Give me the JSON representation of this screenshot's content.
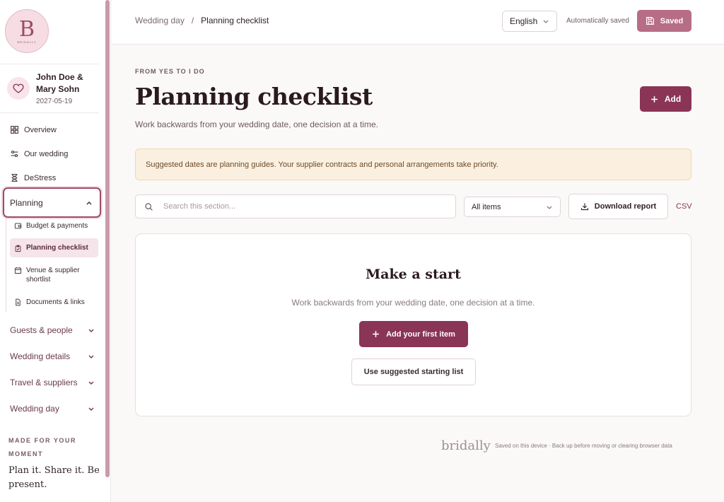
{
  "brand": {
    "logo_letter": "B",
    "logo_caption": "BRIDALLY",
    "footer_name": "bridally"
  },
  "couple": {
    "names": "John Doe & Mary Sohn",
    "date": "2027-05-19"
  },
  "nav": {
    "overview": "Overview",
    "our_wedding": "Our wedding",
    "destress": "DeStress",
    "planning": "Planning",
    "planning_items": [
      {
        "label": "Budget & payments",
        "icon": "wallet-icon"
      },
      {
        "label": "Planning checklist",
        "icon": "clipboard-check-icon",
        "active": true
      },
      {
        "label": "Venue & supplier shortlist",
        "icon": "calendar-icon"
      },
      {
        "label": "Documents & links",
        "icon": "document-icon"
      }
    ],
    "groups": [
      "Guests & people",
      "Wedding details",
      "Travel & suppliers",
      "Wedding day"
    ]
  },
  "sidebar_footer": {
    "eyebrow": "MADE FOR YOUR MOMENT",
    "tagline": "Plan it. Share it. Be present."
  },
  "topbar": {
    "breadcrumb_parent": "Wedding day",
    "breadcrumb_sep": "/",
    "breadcrumb_current": "Planning checklist",
    "language": "English",
    "autosave": "Automatically saved",
    "saved_label": "Saved"
  },
  "main": {
    "eyebrow": "FROM YES TO I DO",
    "title": "Planning checklist",
    "subtitle": "Work backwards from your wedding date, one decision at a time.",
    "add_label": "Add",
    "notice": "Suggested dates are planning guides. Your supplier contracts and personal arrangements take priority.",
    "search_placeholder": "Search this section...",
    "filter_value": "All items",
    "download_label": "Download report",
    "csv_label": "CSV",
    "empty_title": "Make a start",
    "empty_sub": "Work backwards from your wedding date, one decision at a time.",
    "first_item_label": "Add your first item",
    "starter_label": "Use suggested starting list"
  },
  "footer": {
    "note": "Saved on this device · Back up before moving or clearing browser data"
  },
  "colors": {
    "accent": "#8a3456",
    "saved": "#b76d85",
    "notice_bg": "#fbf0e0"
  }
}
